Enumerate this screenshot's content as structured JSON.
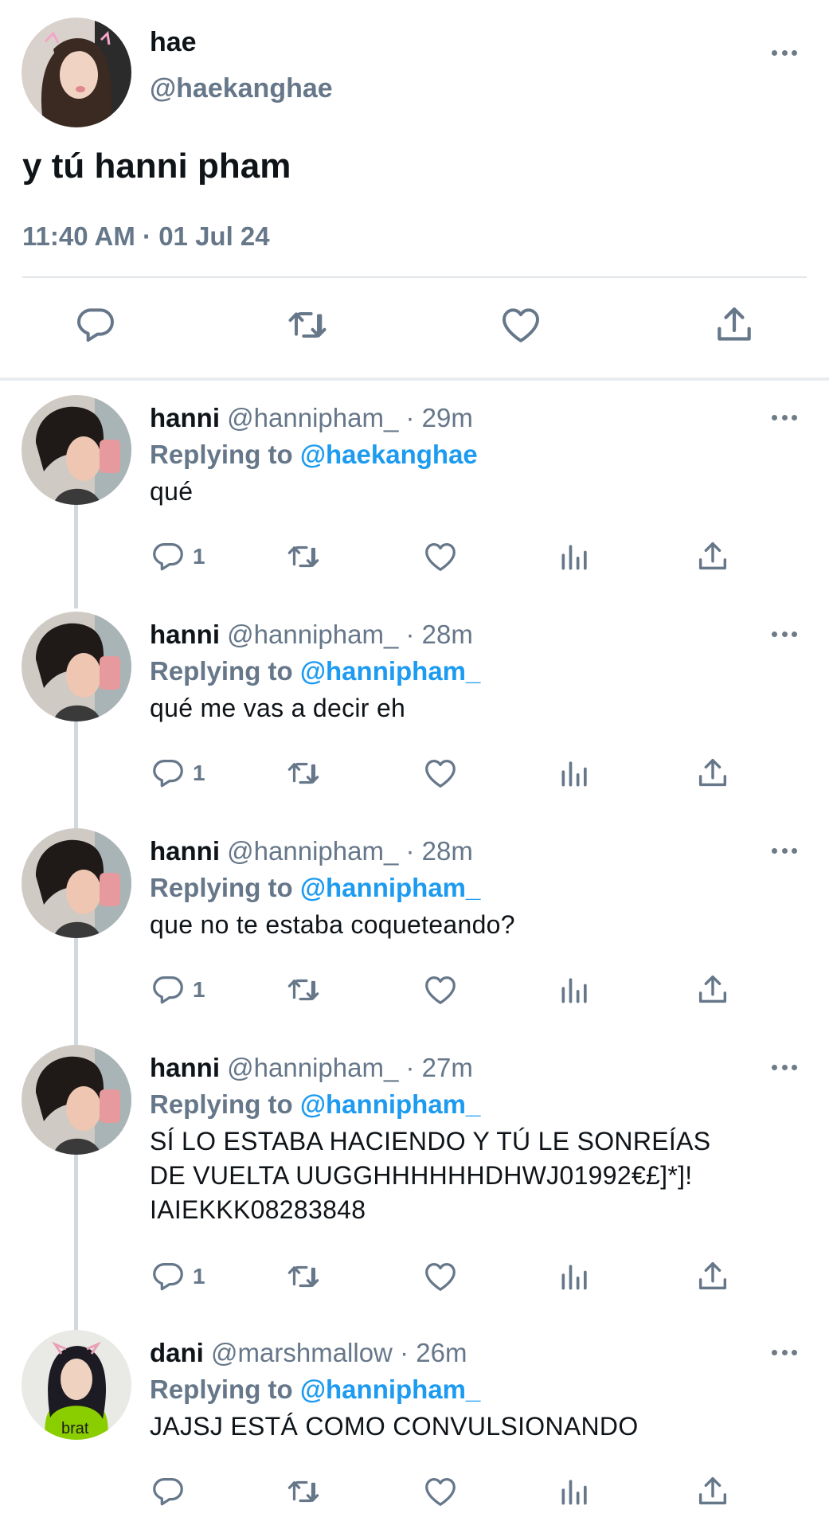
{
  "main_tweet": {
    "author_name": "hae",
    "author_handle": "@haekanghae",
    "text": "y tú hanni pham",
    "time": "11:40 AM",
    "date": "01 Jul 24",
    "actions": [
      "reply-icon",
      "retweet-icon",
      "like-icon",
      "share-icon"
    ]
  },
  "replies": [
    {
      "name": "hanni",
      "handle": "@hannipham_",
      "time": "29m",
      "replying_label": "Replying to",
      "replying_to": "@haekanghae",
      "text": "qué",
      "reply_count": "1"
    },
    {
      "name": "hanni",
      "handle": "@hannipham_",
      "time": "28m",
      "replying_label": "Replying to",
      "replying_to": "@hannipham_",
      "text": "qué me vas a decir eh",
      "reply_count": "1"
    },
    {
      "name": "hanni",
      "handle": "@hannipham_",
      "time": "28m",
      "replying_label": "Replying to",
      "replying_to": "@hannipham_",
      "text": "que no te estaba coqueteando?",
      "reply_count": "1"
    },
    {
      "name": "hanni",
      "handle": "@hannipham_",
      "time": "27m",
      "replying_label": "Replying to",
      "replying_to": "@hannipham_",
      "text_lines": [
        "SÍ LO ESTABA HACIENDO Y TÚ LE SONREÍAS",
        "DE VUELTA UUGGHHHHHHDHWJ01992€£]*]!",
        "IAIEKKK08283848"
      ],
      "reply_count": "1"
    },
    {
      "name": "dani",
      "handle": "@marshmallow",
      "time": "26m",
      "replying_label": "Replying to",
      "replying_to": "@hannipham_",
      "text": "JAJSJ ESTÁ COMO CONVULSIONANDO",
      "avatar_text": "brat",
      "reply_count": ""
    }
  ],
  "separator": "·",
  "colors": {
    "text": "#0f1419",
    "muted": "#66778a",
    "link": "#1d9bf0",
    "divider": "#e3e7ea",
    "brat_green": "#8ace00"
  }
}
